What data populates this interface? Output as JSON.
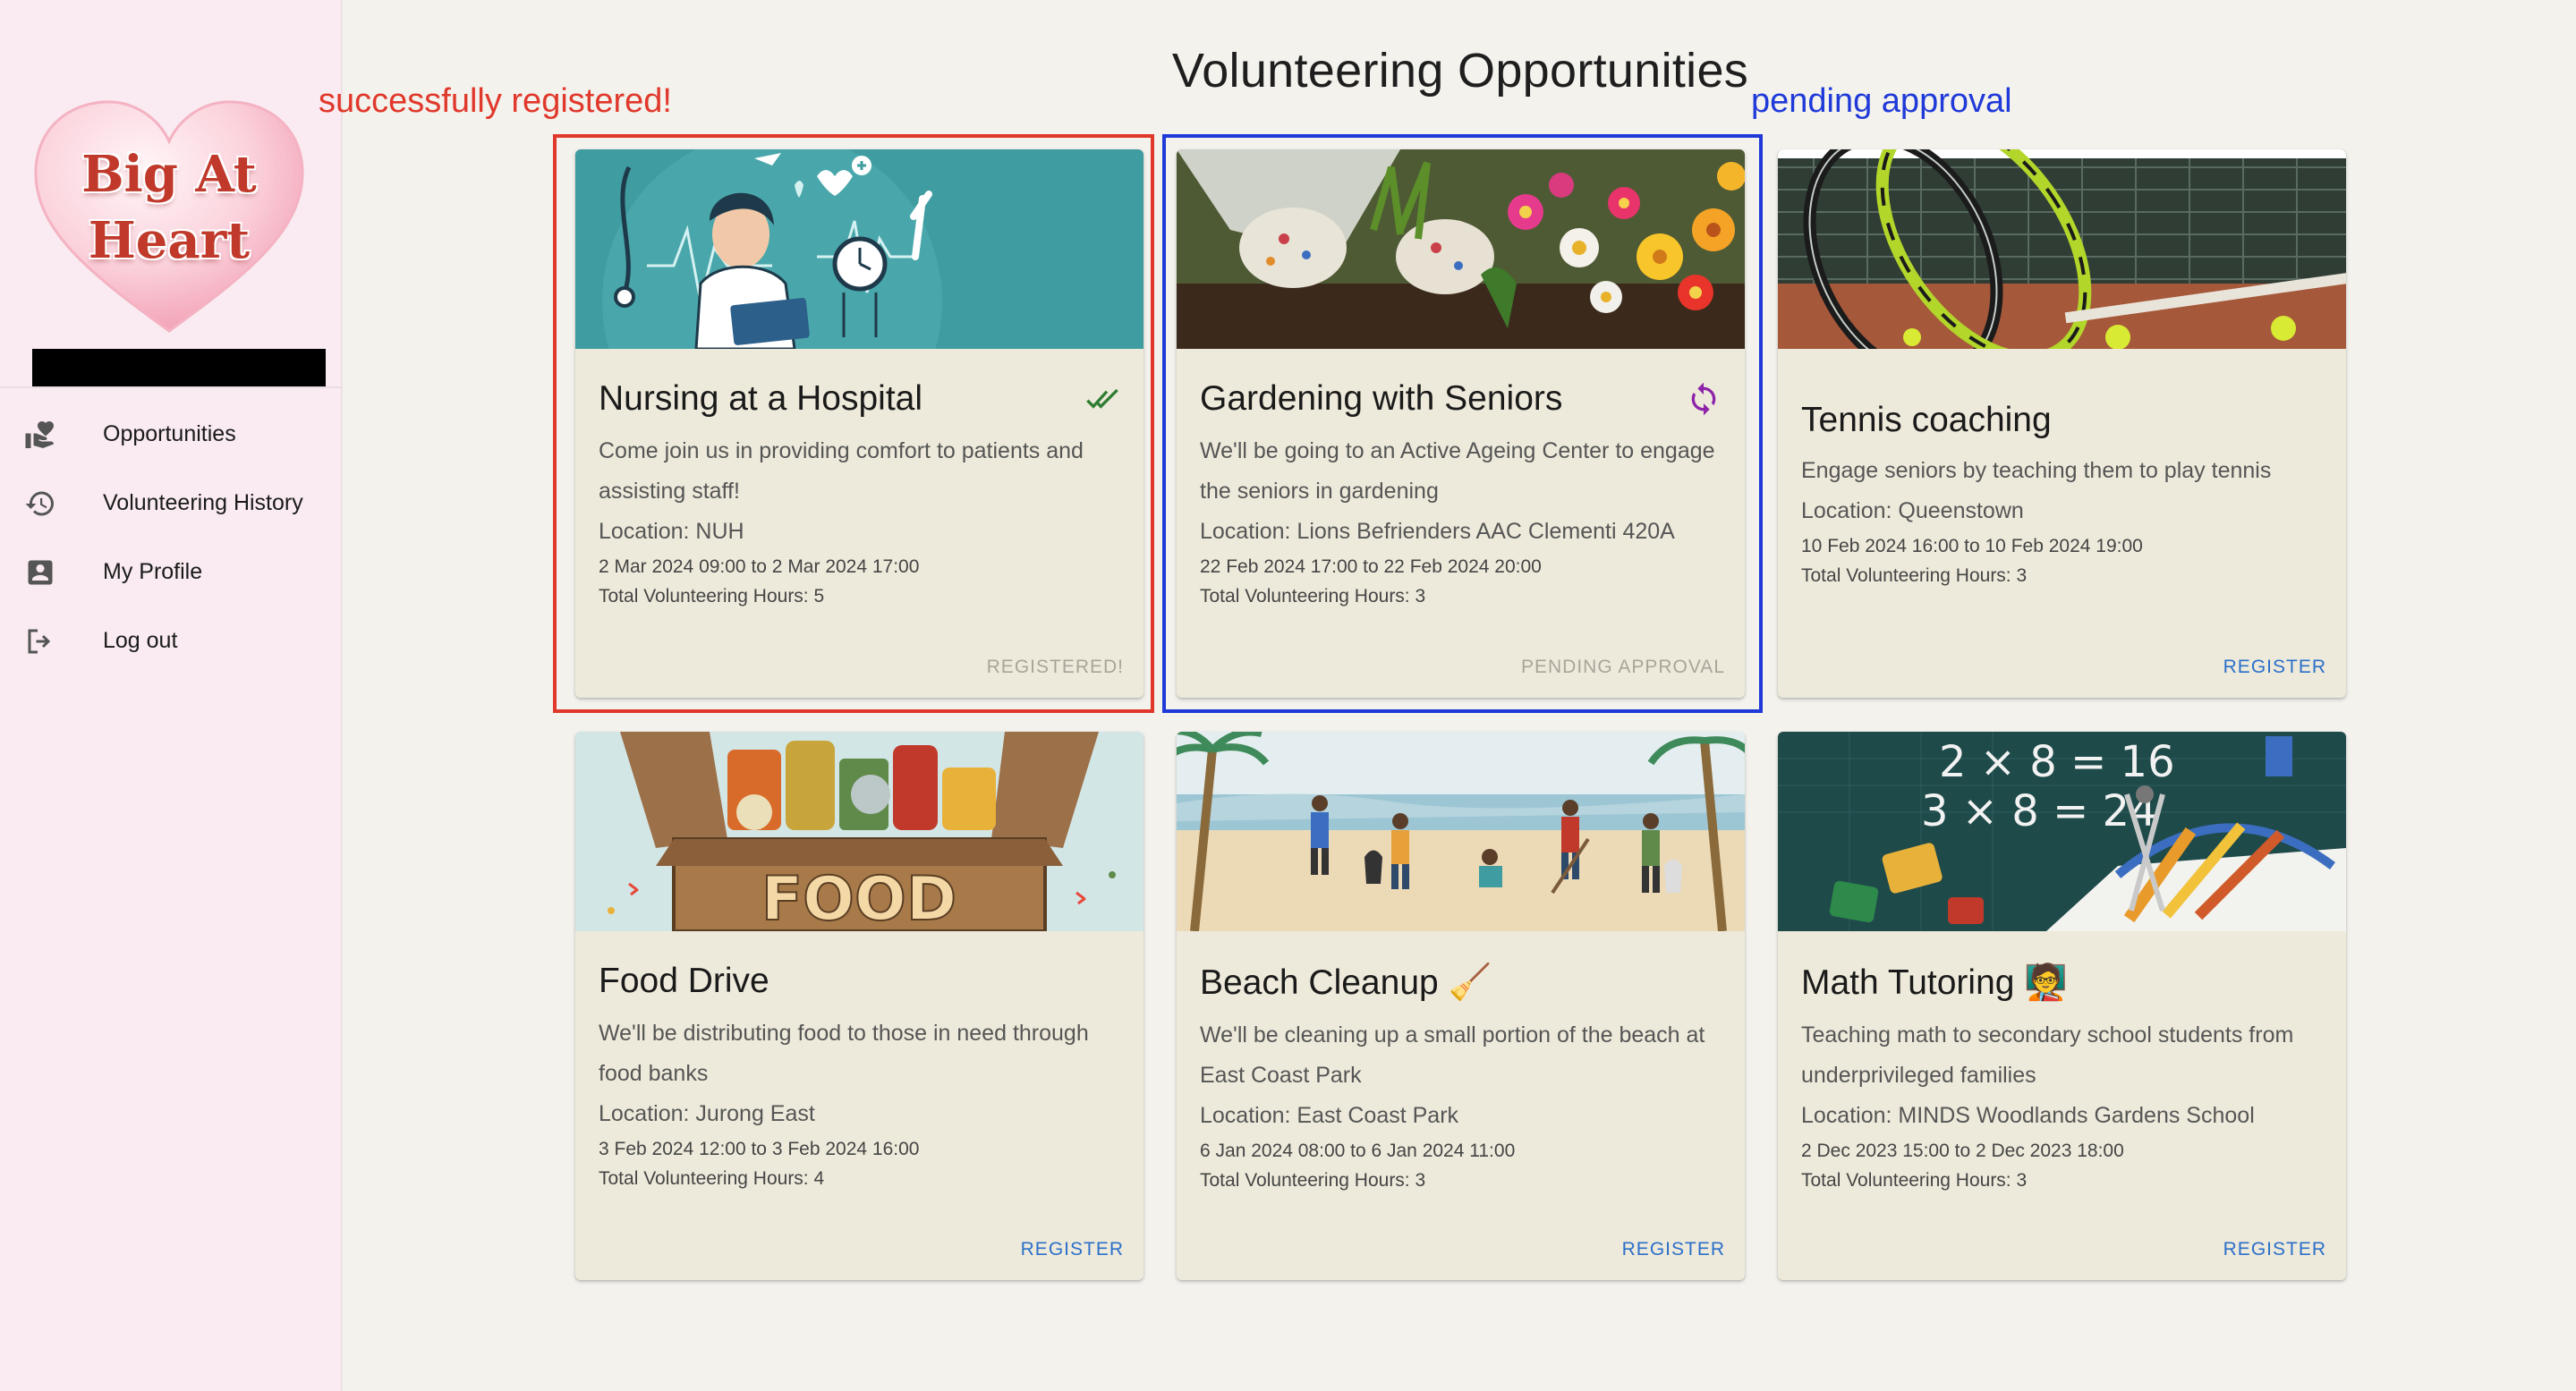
{
  "sidebar": {
    "logo_line1": "Big At",
    "logo_line2": "Heart",
    "items": [
      {
        "label": "Opportunities",
        "icon": "volunteer-hand-heart-icon"
      },
      {
        "label": "Volunteering History",
        "icon": "history-icon"
      },
      {
        "label": "My Profile",
        "icon": "account-box-icon"
      },
      {
        "label": "Log out",
        "icon": "logout-icon"
      }
    ]
  },
  "main": {
    "title": "Volunteering Opportunities",
    "annotation_registered": "successfully registered!",
    "annotation_pending": "pending approval"
  },
  "cards": [
    {
      "title": "Nursing at a Hospital",
      "description": "Come join us in providing comfort to patients and assisting staff!",
      "location": "Location: NUH",
      "dates": "2 Mar 2024 09:00 to 2 Mar 2024 17:00",
      "hours": "Total Volunteering Hours: 5",
      "action": "REGISTERED!",
      "status": "registered",
      "status_icon": "double-check-icon"
    },
    {
      "title": "Gardening with Seniors",
      "description": "We'll be going to an Active Ageing Center to engage the seniors in gardening",
      "location": "Location: Lions Befrienders AAC Clementi 420A",
      "dates": "22 Feb 2024 17:00 to 22 Feb 2024 20:00",
      "hours": "Total Volunteering Hours: 3",
      "action": "PENDING APPROVAL",
      "status": "pending",
      "status_icon": "sync-icon"
    },
    {
      "title": "Tennis coaching",
      "description": "Engage seniors by teaching them to play tennis",
      "location": "Location: Queenstown",
      "dates": "10 Feb 2024 16:00 to 10 Feb 2024 19:00",
      "hours": "Total Volunteering Hours: 3",
      "action": "REGISTER"
    },
    {
      "title": "Food Drive",
      "description": "We'll be distributing food to those in need through food banks",
      "location": "Location: Jurong East",
      "dates": "3 Feb 2024 12:00 to 3 Feb 2024 16:00",
      "hours": "Total Volunteering Hours: 4",
      "action": "REGISTER",
      "image_text": "FOOD"
    },
    {
      "title": "Beach Cleanup 🧹",
      "description": "We'll be cleaning up a small portion of the beach at East Coast Park",
      "location": "Location: East Coast Park",
      "dates": "6 Jan 2024 08:00 to 6 Jan 2024 11:00",
      "hours": "Total Volunteering Hours: 3",
      "action": "REGISTER"
    },
    {
      "title": "Math Tutoring 🧑‍🏫",
      "description": "Teaching math to secondary school students from underprivileged families",
      "location": "Location: MINDS Woodlands Gardens School",
      "dates": "2 Dec 2023 15:00 to 2 Dec 2023 18:00",
      "hours": "Total Volunteering Hours: 3",
      "action": "REGISTER",
      "image_text_1": "2 × 8 = 16",
      "image_text_2": "3 × 8 = 24"
    }
  ],
  "colors": {
    "sidebar_bg": "#f9ebf1",
    "page_bg": "#f4f2ed",
    "card_bg": "#eeeadb",
    "annotation_red": "#e0382b",
    "annotation_blue": "#1f3ad8",
    "action_blue": "#2b6fc9",
    "registered_green": "#2e7d32",
    "pending_purple": "#8e24aa"
  }
}
